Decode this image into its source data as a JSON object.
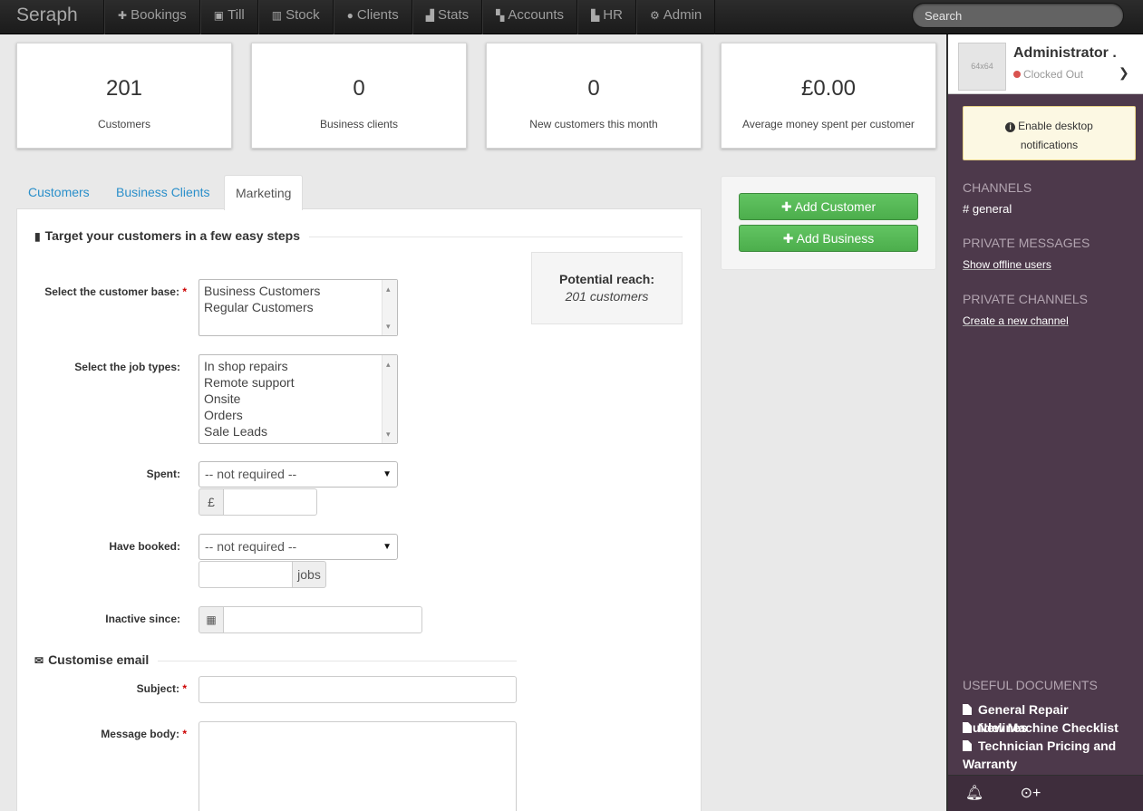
{
  "app": {
    "brand": "Seraph"
  },
  "nav": [
    {
      "label": "Bookings",
      "icon": "plus-icon",
      "glyph": "✚"
    },
    {
      "label": "Till",
      "icon": "money-icon",
      "glyph": "▣"
    },
    {
      "label": "Stock",
      "icon": "barcode-icon",
      "glyph": "▥"
    },
    {
      "label": "Clients",
      "icon": "user-icon",
      "glyph": "●"
    },
    {
      "label": "Stats",
      "icon": "bar-chart-icon",
      "glyph": "▟"
    },
    {
      "label": "Accounts",
      "icon": "book-icon",
      "glyph": "▚"
    },
    {
      "label": "HR",
      "icon": "sitemap-icon",
      "glyph": "▙"
    },
    {
      "label": "Admin",
      "icon": "gears-icon",
      "glyph": "⚙"
    }
  ],
  "search": {
    "placeholder": "Search"
  },
  "stats": [
    {
      "value": "201",
      "label": "Customers"
    },
    {
      "value": "0",
      "label": "Business clients"
    },
    {
      "value": "0",
      "label": "New customers this month"
    },
    {
      "value": "£0.00",
      "label": "Average money spent per customer"
    }
  ],
  "tabs": [
    {
      "label": "Customers",
      "active": false
    },
    {
      "label": "Business Clients",
      "active": false
    },
    {
      "label": "Marketing",
      "active": true
    }
  ],
  "marketing": {
    "section_title": "Target your customers in a few easy steps",
    "customer_base": {
      "label": "Select the customer base:",
      "required": "*",
      "options": [
        "Business Customers",
        "Regular Customers"
      ]
    },
    "job_types": {
      "label": "Select the job types:",
      "options": [
        "In shop repairs",
        "Remote support",
        "Onsite",
        "Orders",
        "Sale Leads"
      ]
    },
    "spent": {
      "label": "Spent:",
      "value": "-- not required --",
      "currency": "£"
    },
    "booked": {
      "label": "Have booked:",
      "value": "-- not required --",
      "suffix": "jobs"
    },
    "inactive": {
      "label": "Inactive since:"
    },
    "email_title": "Customise email",
    "subject": {
      "label": "Subject:",
      "required": "*"
    },
    "message": {
      "label": "Message body:",
      "required": "*"
    },
    "reach": {
      "title": "Potential reach:",
      "value": "201 customers"
    }
  },
  "actions": {
    "add_customer": "Add Customer",
    "add_business": "Add Business"
  },
  "sidebar": {
    "avatar": "64x64",
    "name": "Administrator .",
    "status": "Clocked Out",
    "status_color": "#d9534f",
    "notif_line1": "Enable desktop",
    "notif_line2": "notifications",
    "channels_header": "CHANNELS",
    "channel": "# general",
    "pm_header": "PRIVATE MESSAGES",
    "pm_link": "Show offline users",
    "pc_header": "PRIVATE CHANNELS",
    "pc_link": "Create a new channel",
    "docs_header": "USEFUL DOCUMENTS",
    "docs": [
      "General Repair Guidelines",
      "New Machine Checklist",
      "Technician Pricing and Warranty"
    ]
  }
}
